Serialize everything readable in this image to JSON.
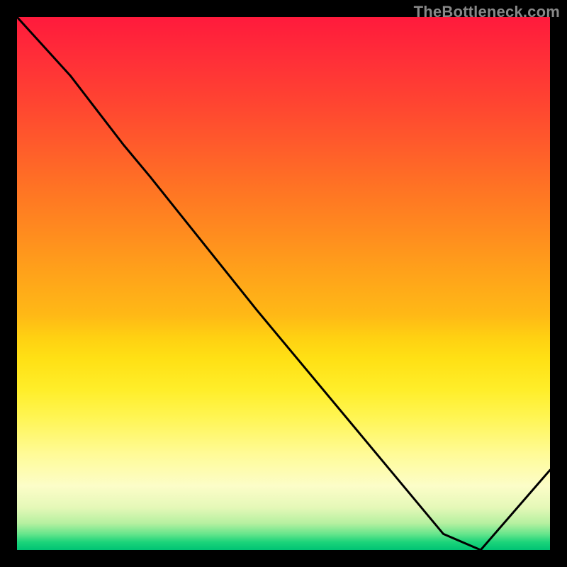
{
  "watermark": "TheBottleneck.com",
  "chart_data": {
    "type": "line",
    "title": "",
    "xlabel": "",
    "ylabel": "",
    "xlim": [
      0,
      100
    ],
    "ylim": [
      0,
      100
    ],
    "series": [
      {
        "name": "curve",
        "x": [
          0,
          10,
          20,
          25,
          45,
          70,
          80,
          87,
          100
        ],
        "values": [
          100,
          89,
          76,
          70,
          45,
          15,
          3,
          0,
          15
        ]
      }
    ],
    "gradient_stops": [
      {
        "pos": 0,
        "color": "#ff1a3c"
      },
      {
        "pos": 50,
        "color": "#ffb400"
      },
      {
        "pos": 80,
        "color": "#fff552"
      },
      {
        "pos": 100,
        "color": "#00c374"
      }
    ],
    "bottom_marker": {
      "text": "",
      "x_percent": 80
    }
  }
}
